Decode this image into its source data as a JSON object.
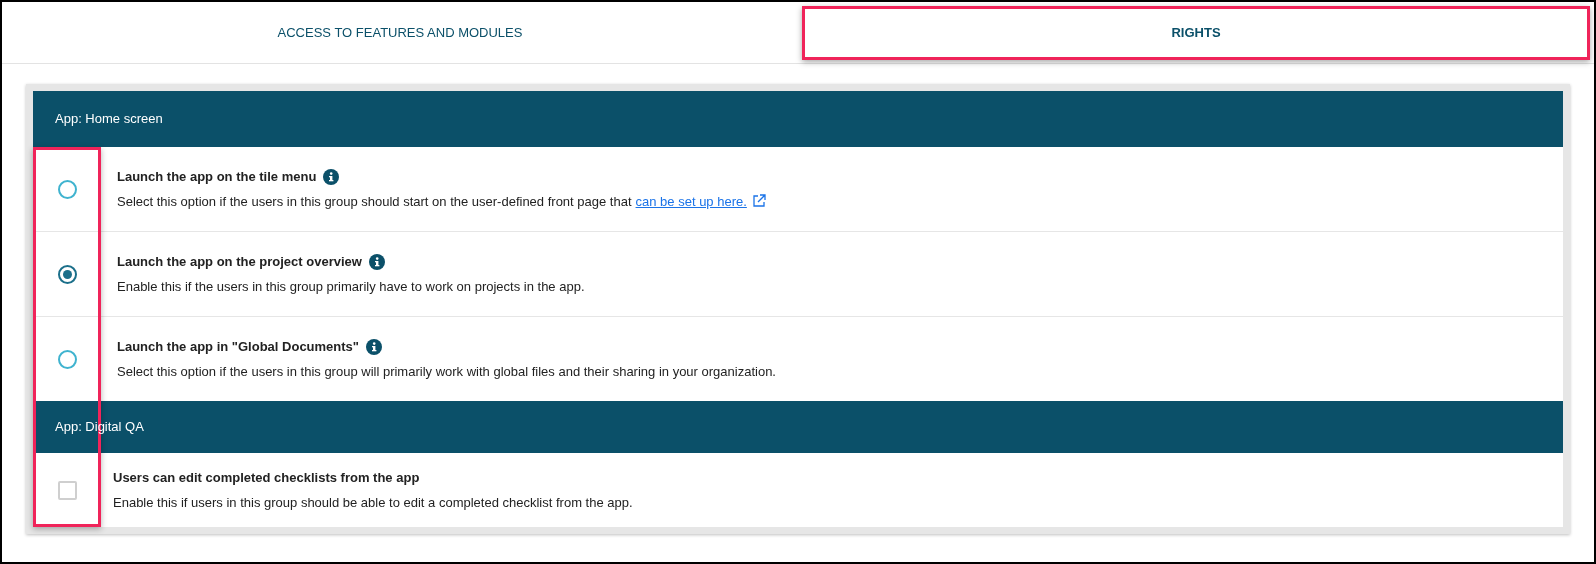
{
  "tabs": [
    {
      "label": "ACCESS TO FEATURES AND MODULES",
      "selected": false,
      "highlighted": false
    },
    {
      "label": "RIGHTS",
      "selected": true,
      "highlighted": true
    }
  ],
  "control_column_highlighted": true,
  "sections": [
    {
      "title": "App: Home screen",
      "options": [
        {
          "kind": "radio",
          "title": "Launch the app on the tile menu",
          "info": true,
          "selected": false,
          "description": "Select this option if the users in this group should start on the user-defined front page that",
          "link": "can be set up here."
        },
        {
          "kind": "radio",
          "title": "Launch the app on the project overview",
          "info": true,
          "selected": true,
          "description": "Enable this if the users in this group primarily have to work on projects in the app."
        },
        {
          "kind": "radio",
          "title": "Launch the app in \"Global Documents\"",
          "info": true,
          "selected": false,
          "description": "Select this option if the users in this group will primarily work with global files and their sharing in your organization."
        }
      ]
    },
    {
      "title": "App: Digital QA",
      "options": [
        {
          "kind": "checkbox",
          "title": "Users can edit completed checklists from the app",
          "info": false,
          "checked": false,
          "description": "Enable this if users in this group should be able to edit a completed checklist from the app."
        }
      ]
    }
  ]
}
